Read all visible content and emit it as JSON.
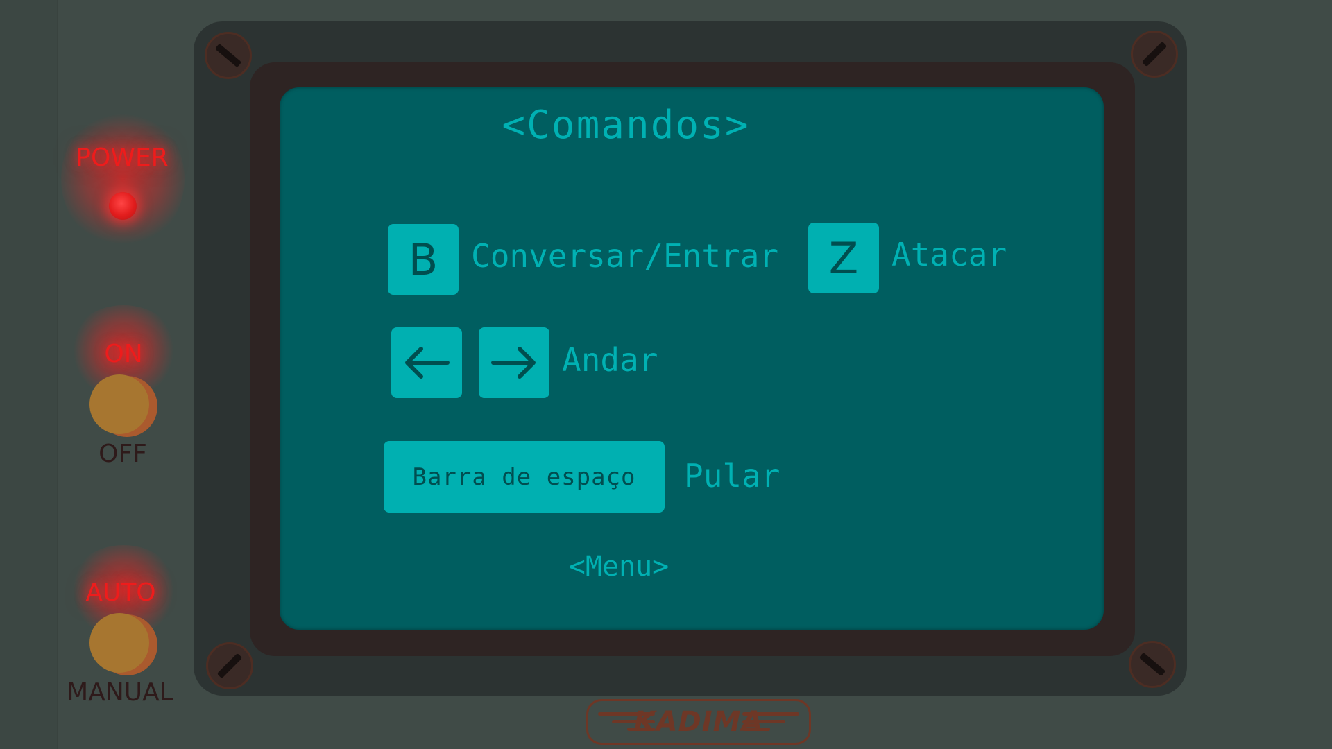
{
  "panel": {
    "power_label": "POWER",
    "on_label": "ON",
    "off_label": "OFF",
    "auto_label": "AUTO",
    "manual_label": "MANUAL"
  },
  "screen": {
    "title": "<Comandos>",
    "commands": [
      {
        "key": "B",
        "action": "Conversar/Entrar"
      },
      {
        "key": "Z",
        "action": "Atacar"
      },
      {
        "keys": [
          "left-arrow-icon",
          "right-arrow-icon"
        ],
        "action": "Andar"
      },
      {
        "key": "Barra de espaço",
        "action": "Pular"
      }
    ],
    "menu_label": "<Menu>"
  },
  "logo": {
    "text": "KADIMA"
  },
  "colors": {
    "background": "#404b47",
    "screen": "#005e60",
    "screen_text": "#00b1b3",
    "key_fill": "#00b0b1",
    "key_text": "#004e4f",
    "indicator_red": "#ee1c1c",
    "knob": "#a77630",
    "bezel": "#2e2423",
    "monitor_frame": "#2c3332",
    "logo_brown": "#6e3726"
  }
}
